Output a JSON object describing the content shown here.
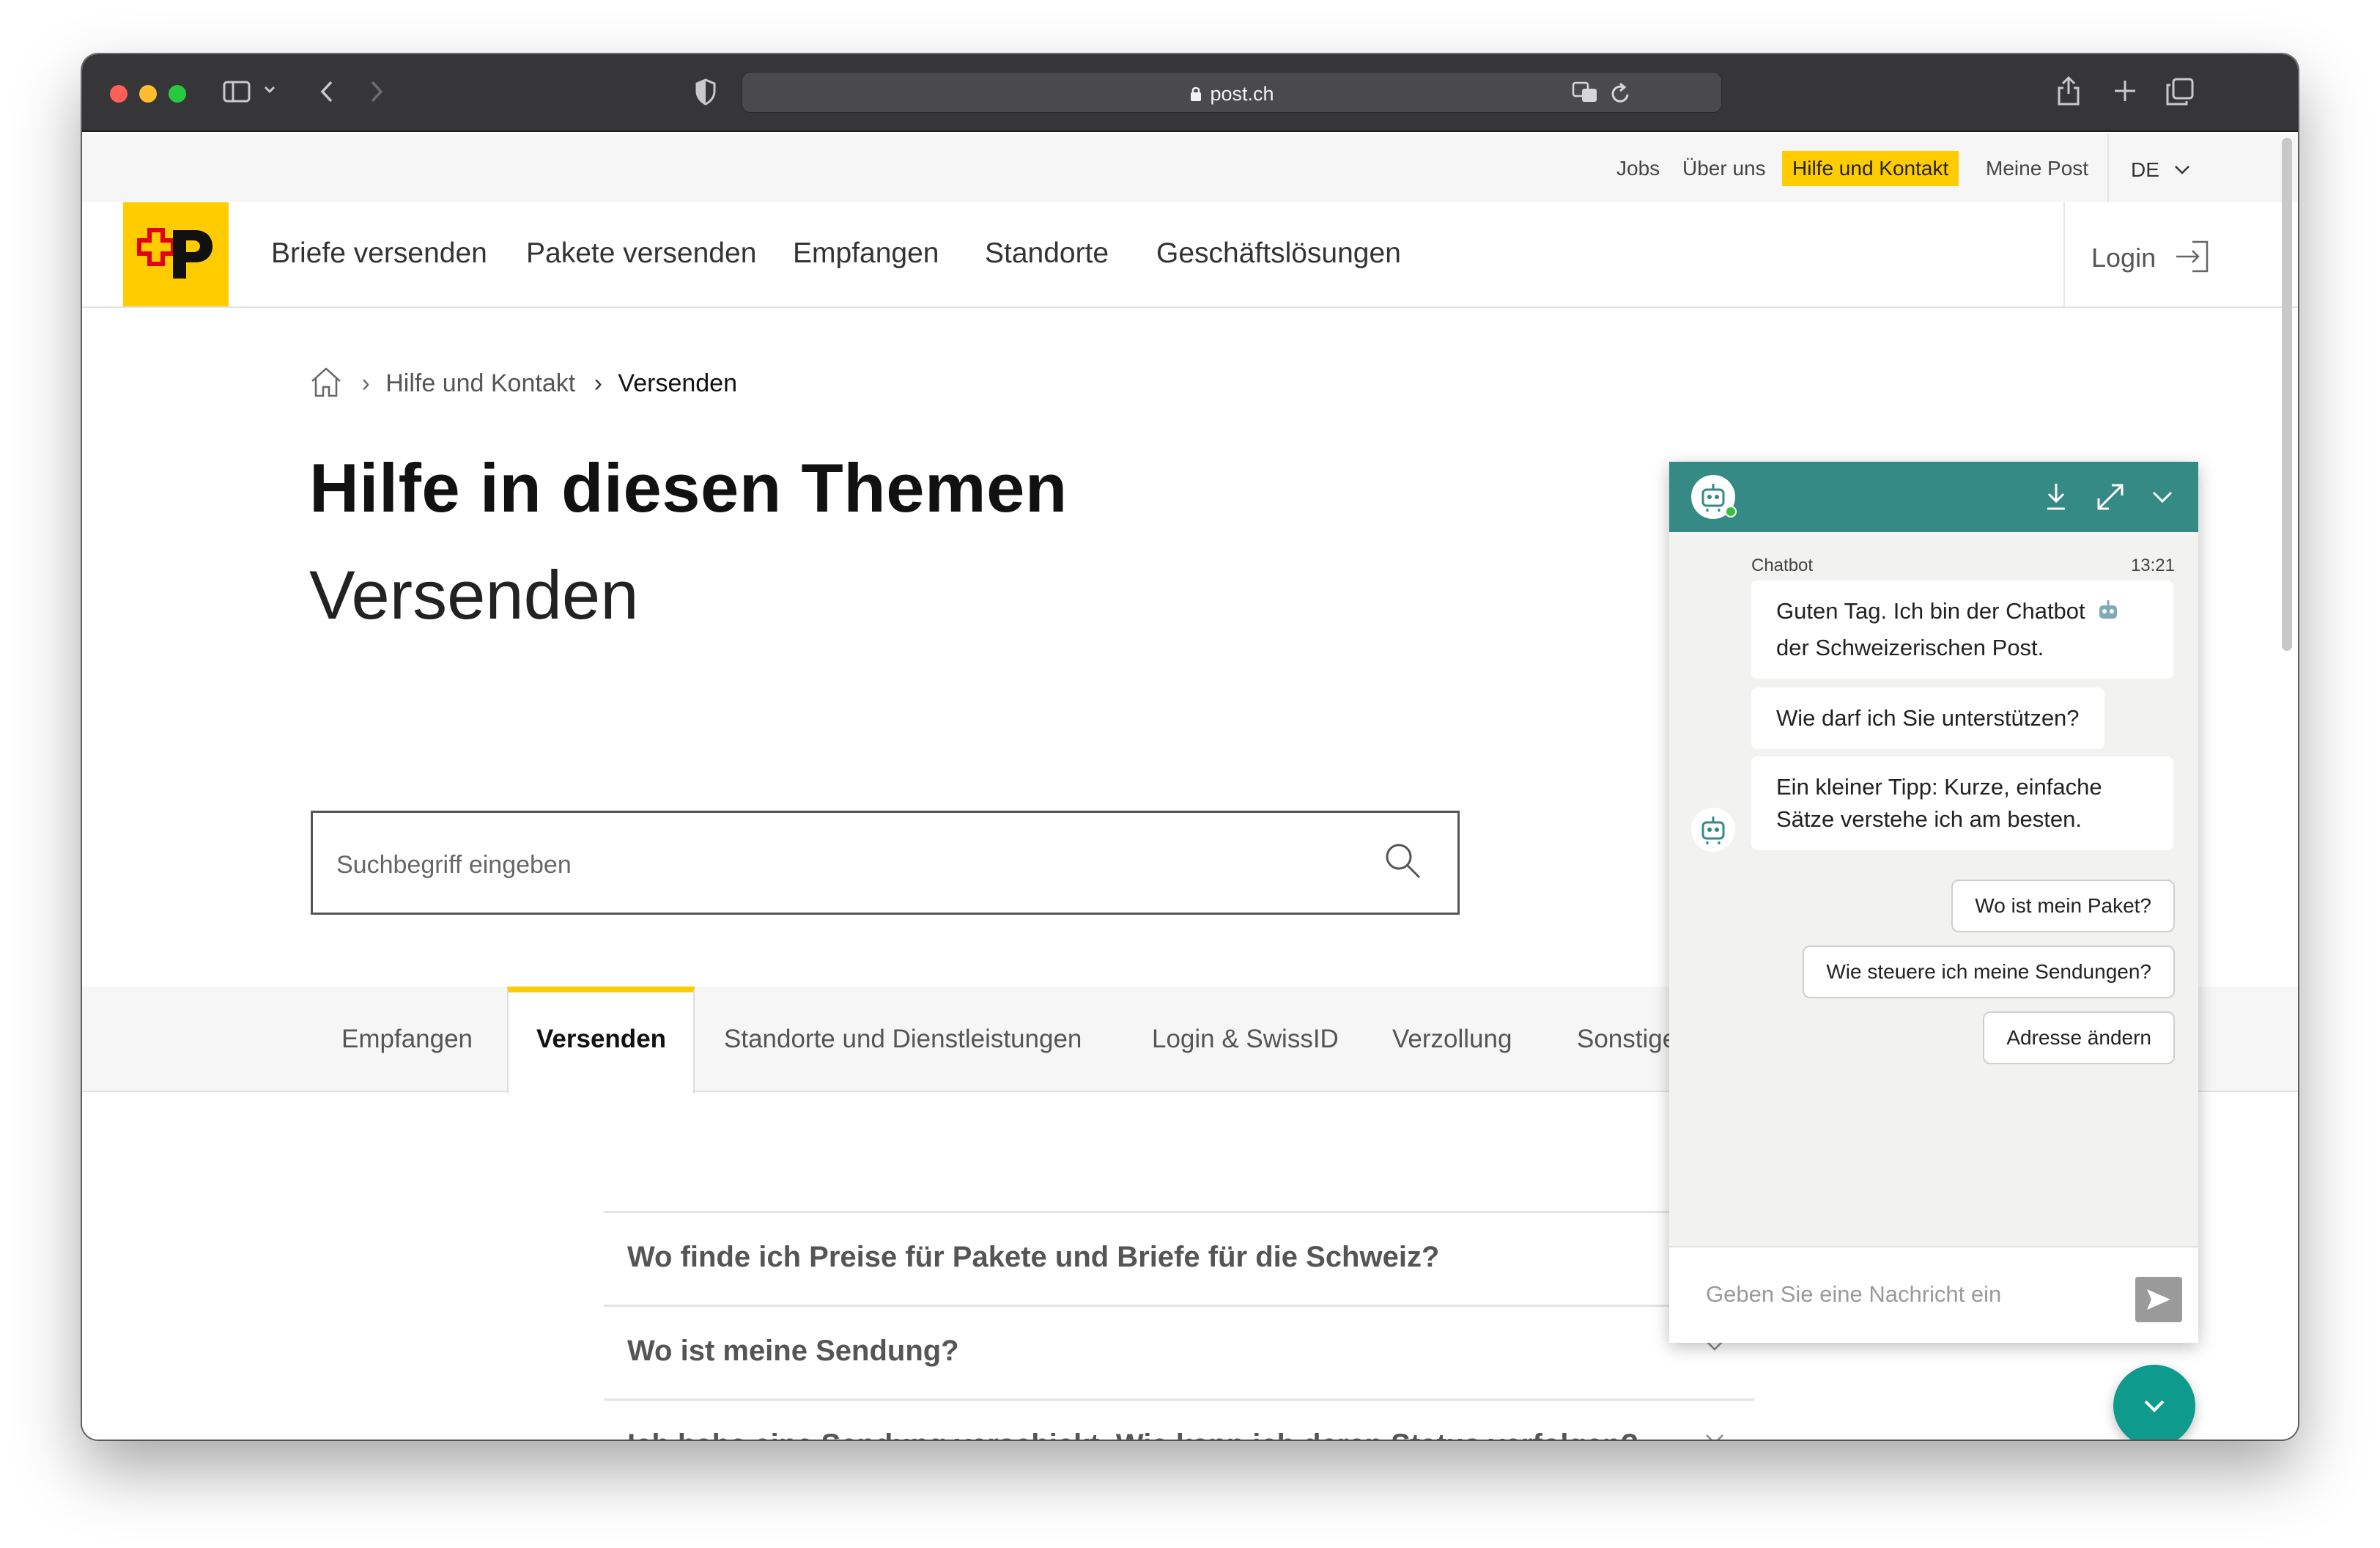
{
  "browser": {
    "url": "post.ch"
  },
  "topbar": {
    "links": [
      {
        "label": "Jobs"
      },
      {
        "label": "Über uns"
      },
      {
        "label": "Hilfe und Kontakt"
      },
      {
        "label": "Meine Post"
      }
    ],
    "language": "DE"
  },
  "nav": {
    "items": [
      {
        "label": "Briefe versenden"
      },
      {
        "label": "Pakete versenden"
      },
      {
        "label": "Empfangen"
      },
      {
        "label": "Standorte"
      },
      {
        "label": "Geschäftslösungen"
      }
    ],
    "login_label": "Login"
  },
  "breadcrumb": {
    "items": [
      {
        "label": "Hilfe und Kontakt"
      },
      {
        "label": "Versenden"
      }
    ]
  },
  "main": {
    "title": "Hilfe in diesen Themen",
    "subtitle": "Versenden",
    "search_placeholder": "Suchbegriff eingeben"
  },
  "tabs": [
    {
      "label": "Empfangen"
    },
    {
      "label": "Versenden"
    },
    {
      "label": "Standorte und Dienstleistungen"
    },
    {
      "label": "Login & SwissID"
    },
    {
      "label": "Verzollung"
    },
    {
      "label": "Sonstige"
    }
  ],
  "faq": [
    {
      "question": "Wo finde ich Preise für Pakete und Briefe für die Schweiz?"
    },
    {
      "question": "Wo ist meine Sendung?"
    },
    {
      "question": "Ich habe eine Sendung verschickt. Wie kann ich deren Status verfolgen?"
    }
  ],
  "chat": {
    "sender": "Chatbot",
    "time": "13:21",
    "messages": [
      {
        "line1": "Guten Tag. Ich bin der Chatbot",
        "line2": "der Schweizerischen Post."
      },
      {
        "line1": "Wie darf ich Sie unterstützen?"
      },
      {
        "line1": "Ein kleiner Tipp: Kurze, einfache",
        "line2": "Sätze verstehe ich am besten."
      }
    ],
    "quick_replies": [
      {
        "label": "Wo ist mein Paket?"
      },
      {
        "label": "Wie steuere ich meine Sendungen?"
      },
      {
        "label": "Adresse ändern"
      }
    ],
    "input_placeholder": "Geben Sie eine Nachricht ein"
  },
  "colors": {
    "brand_yellow": "#ffcc00",
    "chat_header": "#368a86",
    "fab": "#0f9a8e"
  }
}
